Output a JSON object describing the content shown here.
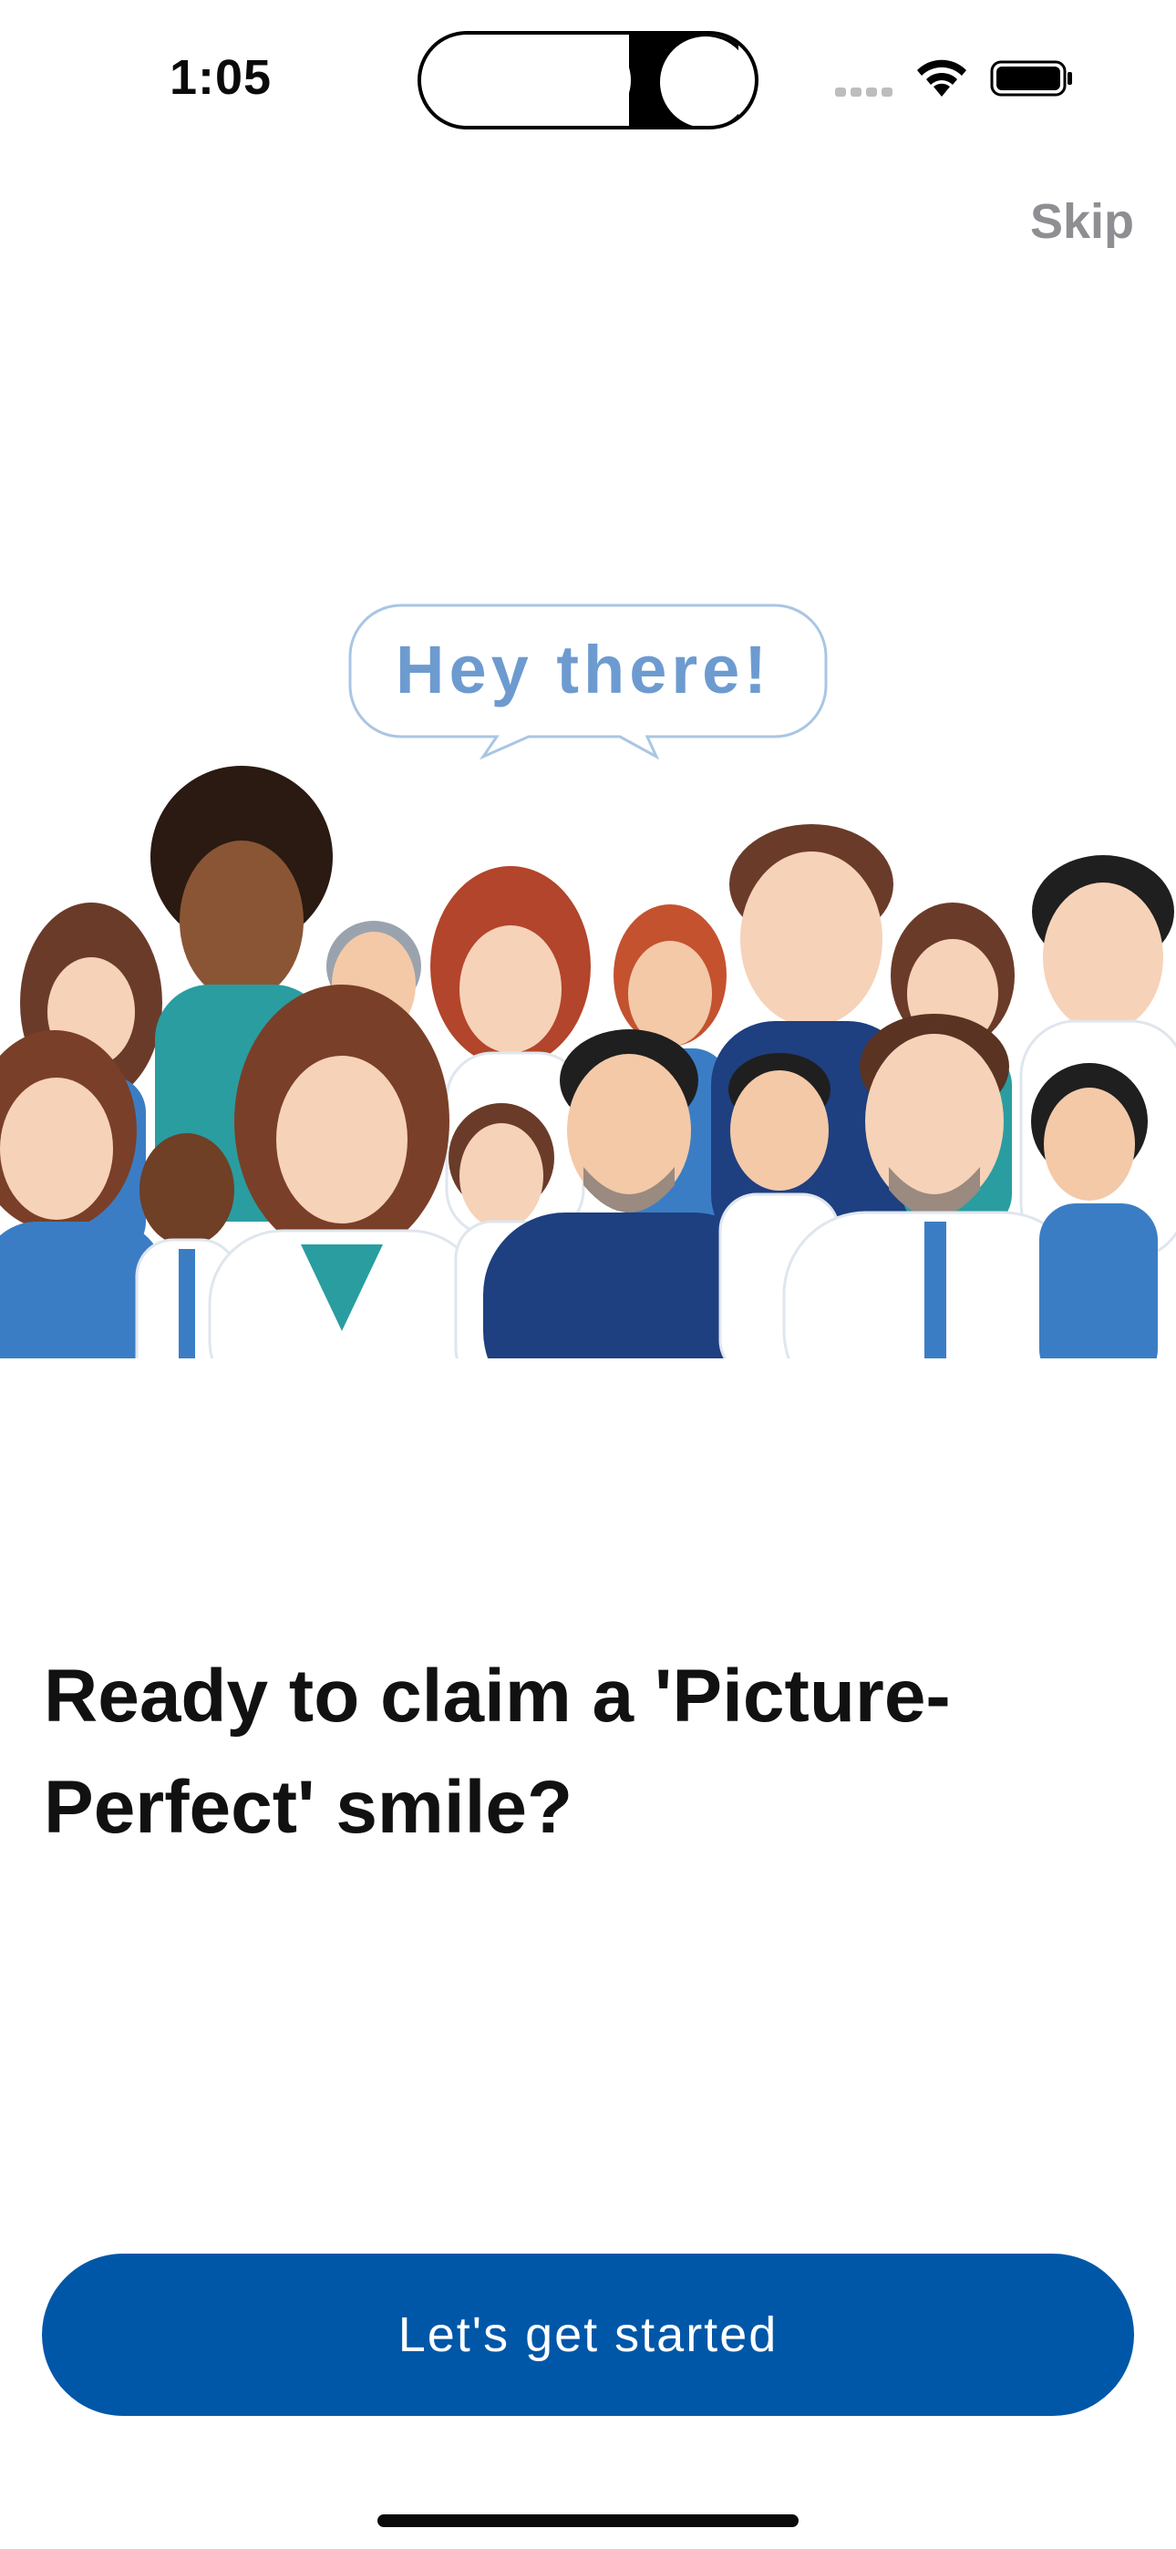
{
  "status_bar": {
    "time": "1:05"
  },
  "header": {
    "skip_label": "Skip"
  },
  "illustration": {
    "speech_bubble_text": "Hey there!"
  },
  "main": {
    "headline": "Ready to claim a 'Picture-Perfect' smile?"
  },
  "footer": {
    "cta_label": "Let's get started"
  },
  "colors": {
    "primary_button": "#0057a8",
    "skip_text": "#8e8e93",
    "bubble_text": "#6d9bd0",
    "scrubs_dark": "#1e3f80",
    "scrubs_light": "#3b7dc4",
    "scrubs_teal": "#2a9da0"
  }
}
